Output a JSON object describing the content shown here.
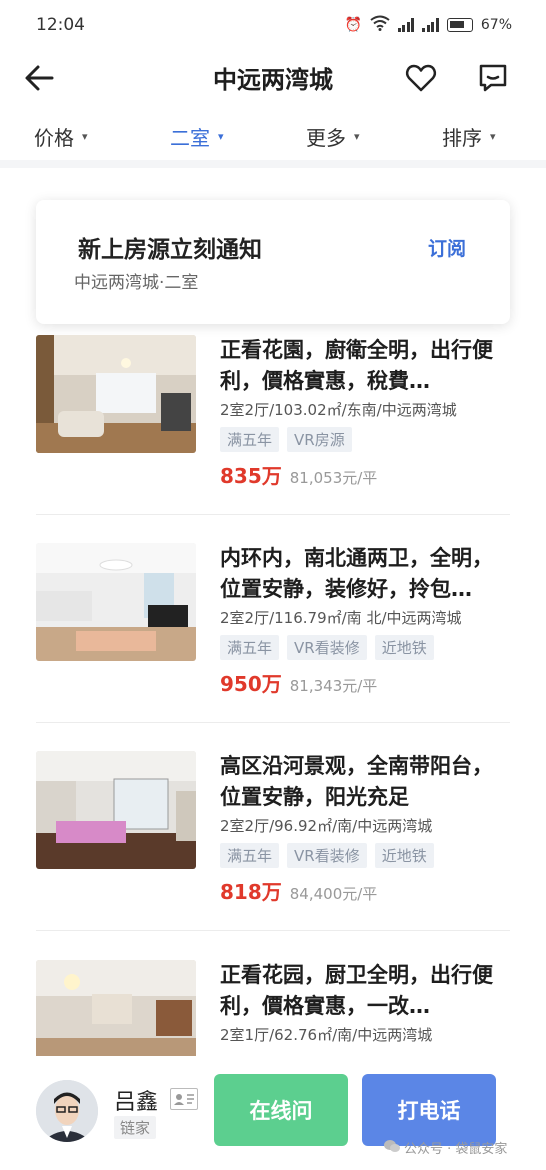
{
  "status_bar": {
    "time": "12:04",
    "battery": "67%"
  },
  "header": {
    "title": "中远两湾城"
  },
  "filters": [
    {
      "label": "价格",
      "active": false
    },
    {
      "label": "二室",
      "active": true
    },
    {
      "label": "更多",
      "active": false
    },
    {
      "label": "排序",
      "active": false
    }
  ],
  "subscribe": {
    "title": "新上房源立刻通知",
    "subtitle": "中远两湾城·二室",
    "button": "订阅"
  },
  "listings": [
    {
      "title": "正看花園，廚衛全明，出行便利，價格實惠，稅費…",
      "meta": "2室2厅/103.02㎡/东南/中远两湾城",
      "tags": [
        "满五年",
        "VR房源"
      ],
      "price": "835万",
      "unit_price": "81,053元/平"
    },
    {
      "title": "内环内，南北通两卫，全明，位置安静，装修好，拎包…",
      "meta": "2室2厅/116.79㎡/南 北/中远两湾城",
      "tags": [
        "满五年",
        "VR看装修",
        "近地铁"
      ],
      "price": "950万",
      "unit_price": "81,343元/平"
    },
    {
      "title": "高区沿河景观，全南带阳台，位置安静，阳光充足",
      "meta": "2室2厅/96.92㎡/南/中远两湾城",
      "tags": [
        "满五年",
        "VR看装修",
        "近地铁"
      ],
      "price": "818万",
      "unit_price": "84,400元/平"
    },
    {
      "title": "正看花园，厨卫全明，出行便利，價格實惠，一改…",
      "meta": "2室1厅/62.76㎡/南/中远两湾城",
      "tags": [],
      "price": "",
      "unit_price": ""
    }
  ],
  "agent": {
    "name": "吕鑫",
    "company": "链家"
  },
  "actions": {
    "chat": "在线问",
    "call": "打电话"
  },
  "watermark": "公众号 · 袋鼠安家",
  "colors": {
    "accent_blue": "#3b6fd8",
    "price_red": "#e0392b",
    "chat_green": "#5ccf8f",
    "call_blue": "#5b86e6"
  }
}
